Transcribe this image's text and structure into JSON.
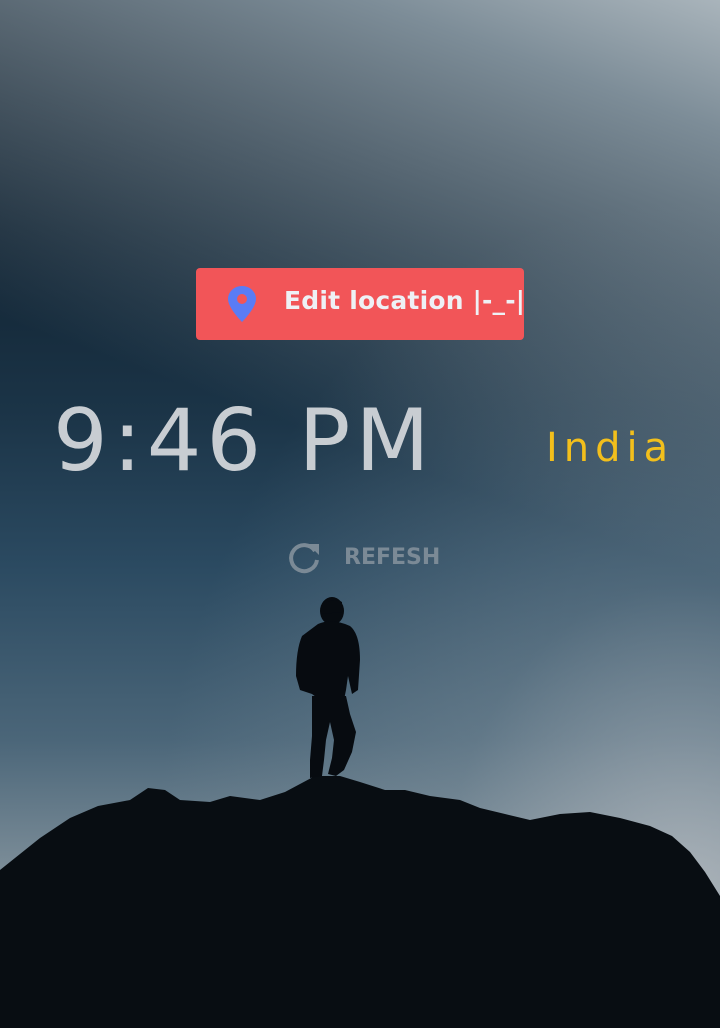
{
  "edit_location": {
    "label": "Edit location |-_-|",
    "icon": "map-pin-icon",
    "background_color": "#f25558",
    "icon_color": "#5a7cf5"
  },
  "clock": {
    "time": "9:46 PM",
    "location": "India",
    "time_color": "#c8cdd2",
    "location_color": "#f2bf1c"
  },
  "refresh": {
    "label": "REFESH",
    "icon": "refresh-icon"
  }
}
